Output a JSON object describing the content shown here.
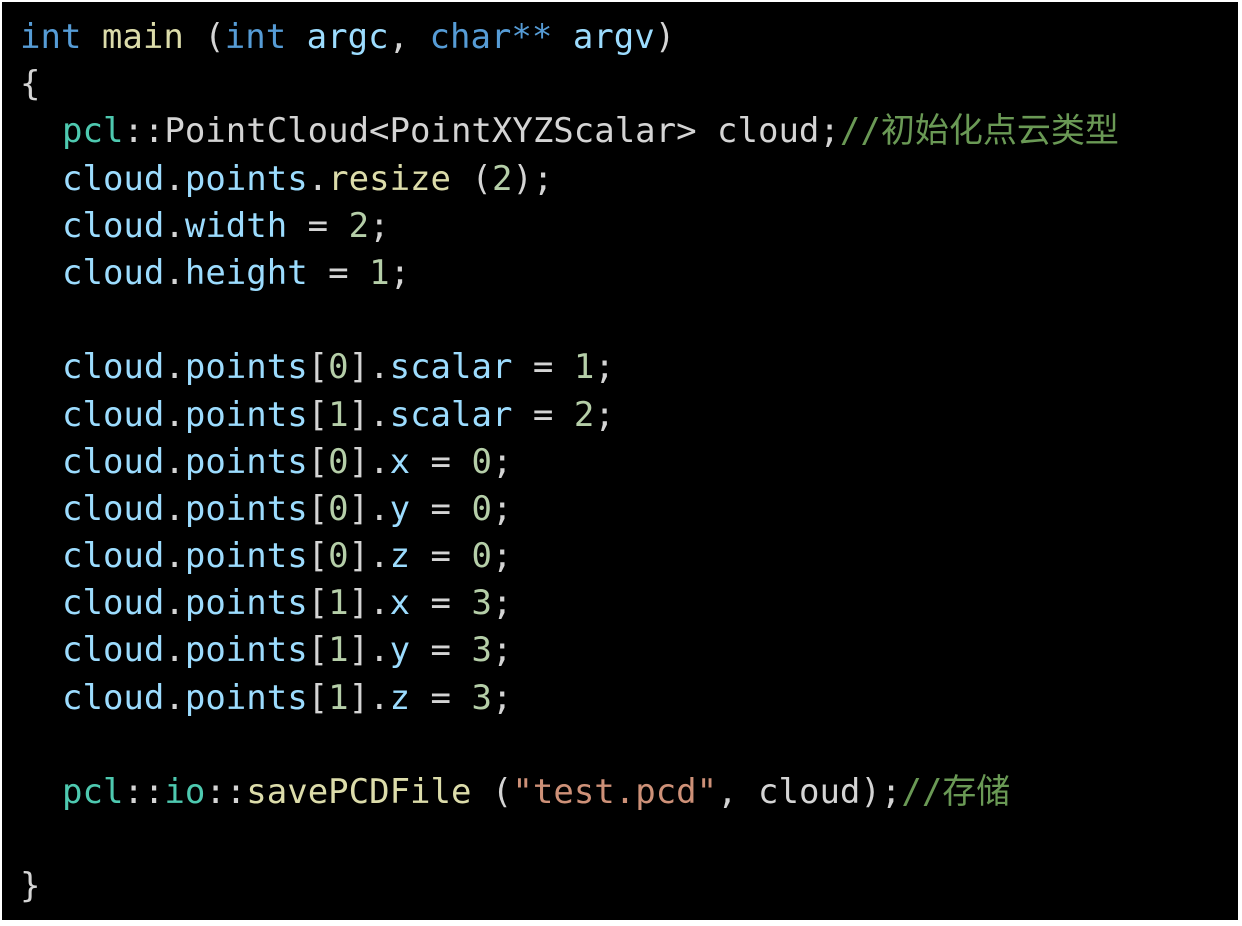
{
  "signature": {
    "kw_int": "int",
    "fn_main": "main",
    "open": " (",
    "kw_int2": "int",
    "argc": "argc",
    "comma": ", ",
    "char_type": "char**",
    "argv": "argv",
    "close": ")"
  },
  "brace_open": "{",
  "decl": {
    "ns": "pcl",
    "rest": "::PointCloud<PointXYZScalar> cloud;",
    "comment": "//初始化点云类型"
  },
  "resize": {
    "obj": "cloud",
    "dot": ".",
    "field": "points",
    "dot2": ".",
    "method": "resize",
    "open": " (",
    "arg": "2",
    "close": ");"
  },
  "width_line": {
    "obj": "cloud",
    "dot": ".",
    "field": "width",
    "eq": " = ",
    "val": "2",
    "end": ";"
  },
  "height_line": {
    "obj": "cloud",
    "dot": ".",
    "field": "height",
    "eq": " = ",
    "val": "1",
    "end": ";"
  },
  "assignments": [
    {
      "obj": "cloud",
      "dot": ".",
      "arr": "points",
      "open": "[",
      "idx": "0",
      "close": "].",
      "field": "scalar",
      "eq": " = ",
      "val": "1",
      "end": ";"
    },
    {
      "obj": "cloud",
      "dot": ".",
      "arr": "points",
      "open": "[",
      "idx": "1",
      "close": "].",
      "field": "scalar",
      "eq": " = ",
      "val": "2",
      "end": ";"
    },
    {
      "obj": "cloud",
      "dot": ".",
      "arr": "points",
      "open": "[",
      "idx": "0",
      "close": "].",
      "field": "x",
      "eq": " = ",
      "val": "0",
      "end": ";"
    },
    {
      "obj": "cloud",
      "dot": ".",
      "arr": "points",
      "open": "[",
      "idx": "0",
      "close": "].",
      "field": "y",
      "eq": " = ",
      "val": "0",
      "end": ";"
    },
    {
      "obj": "cloud",
      "dot": ".",
      "arr": "points",
      "open": "[",
      "idx": "0",
      "close": "].",
      "field": "z",
      "eq": " = ",
      "val": "0",
      "end": ";"
    },
    {
      "obj": "cloud",
      "dot": ".",
      "arr": "points",
      "open": "[",
      "idx": "1",
      "close": "].",
      "field": "x",
      "eq": " = ",
      "val": "3",
      "end": ";"
    },
    {
      "obj": "cloud",
      "dot": ".",
      "arr": "points",
      "open": "[",
      "idx": "1",
      "close": "].",
      "field": "y",
      "eq": " = ",
      "val": "3",
      "end": ";"
    },
    {
      "obj": "cloud",
      "dot": ".",
      "arr": "points",
      "open": "[",
      "idx": "1",
      "close": "].",
      "field": "z",
      "eq": " = ",
      "val": "3",
      "end": ";"
    }
  ],
  "save": {
    "ns": "pcl",
    "sep": "::",
    "ns2": "io",
    "sep2": "::",
    "fn": "savePCDFile",
    "open": " (",
    "str": "\"test.pcd\"",
    "rest": ", cloud);",
    "comment": "//存储"
  },
  "brace_close": "}",
  "colors": {
    "background": "#000000",
    "keyword": "#569cd6",
    "function": "#dcdcaa",
    "variable": "#9cdcfe",
    "type": "#4ec9b0",
    "number": "#b5cea8",
    "string": "#ce9178",
    "comment": "#6a9955",
    "text": "#d4d4d4"
  }
}
